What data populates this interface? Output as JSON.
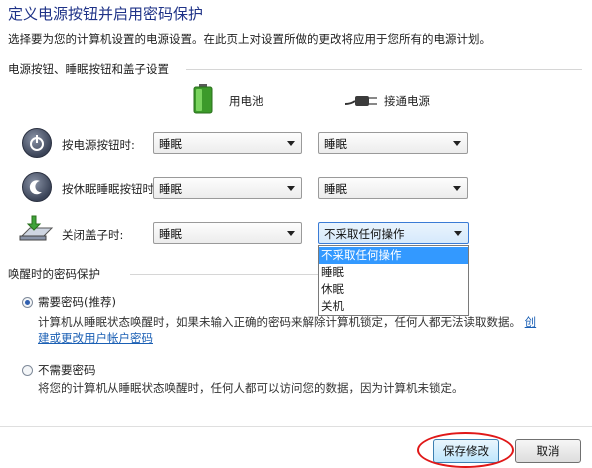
{
  "header": {
    "title": "定义电源按钮并启用密码保护",
    "description": "选择要为您的计算机设置的电源设置。在此页上对设置所做的更改将应用于您所有的电源计划。"
  },
  "power_section": {
    "title": "电源按钮、睡眠按钮和盖子设置",
    "col_battery": "用电池",
    "col_plugged": "接通电源",
    "rows": [
      {
        "label": "按电源按钮时:",
        "battery": "睡眠",
        "plugged": "睡眠"
      },
      {
        "label": "按休眠睡眠按钮时:",
        "battery": "睡眠",
        "plugged": "睡眠"
      },
      {
        "label": "关闭盖子时:",
        "battery": "睡眠",
        "plugged": "不采取任何操作"
      }
    ],
    "dropdown_options": [
      "不采取任何操作",
      "睡眠",
      "休眠",
      "关机"
    ],
    "dropdown_selected_index": 0
  },
  "password_section": {
    "title": "唤醒时的密码保护",
    "require": {
      "label": "需要密码(推荐)",
      "desc_line1": "计算机从睡眠状态唤醒时，如果未输入正确的密码来解除计算机锁定，任何人都无法读取数据。",
      "link_part1": "创",
      "link_part2": "建或更改用户帐户密码"
    },
    "no_require": {
      "label": "不需要密码",
      "desc": "将您的计算机从睡眠状态唤醒时，任何人都可以访问您的数据，因为计算机未锁定。"
    }
  },
  "footer": {
    "save_label": "保存修改",
    "cancel_label": "取消"
  },
  "colors": {
    "title": "#1e3287",
    "link": "#1a5fb4",
    "selection": "#3399ff",
    "highlight_ellipse": "#e01818"
  }
}
